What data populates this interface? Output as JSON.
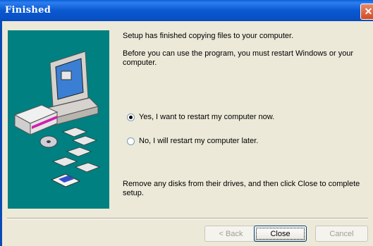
{
  "window": {
    "title": "Finished",
    "close_glyph": "✕"
  },
  "messages": {
    "copied": "Setup has finished copying files to your computer.",
    "restart_line1": "Before you can use the program, you must restart Windows or your",
    "restart_line2": "computer.",
    "remove_disks": "Remove any disks from their drives, and then click Close to complete setup."
  },
  "options": {
    "restart_now": {
      "label": "Yes, I want to restart my computer now.",
      "selected": true
    },
    "restart_later": {
      "label": "No, I will restart my computer later.",
      "selected": false
    }
  },
  "buttons": {
    "back": "< Back",
    "close": "Close",
    "cancel": "Cancel"
  },
  "icons": [
    "computer-icon",
    "floppy-disk-icon",
    "cd-icon",
    "installer-icon",
    "close-icon"
  ],
  "colors": {
    "illustration_bg": "#008080",
    "titlebar": "#0a58d0",
    "dialog_bg": "#ece9d8"
  }
}
